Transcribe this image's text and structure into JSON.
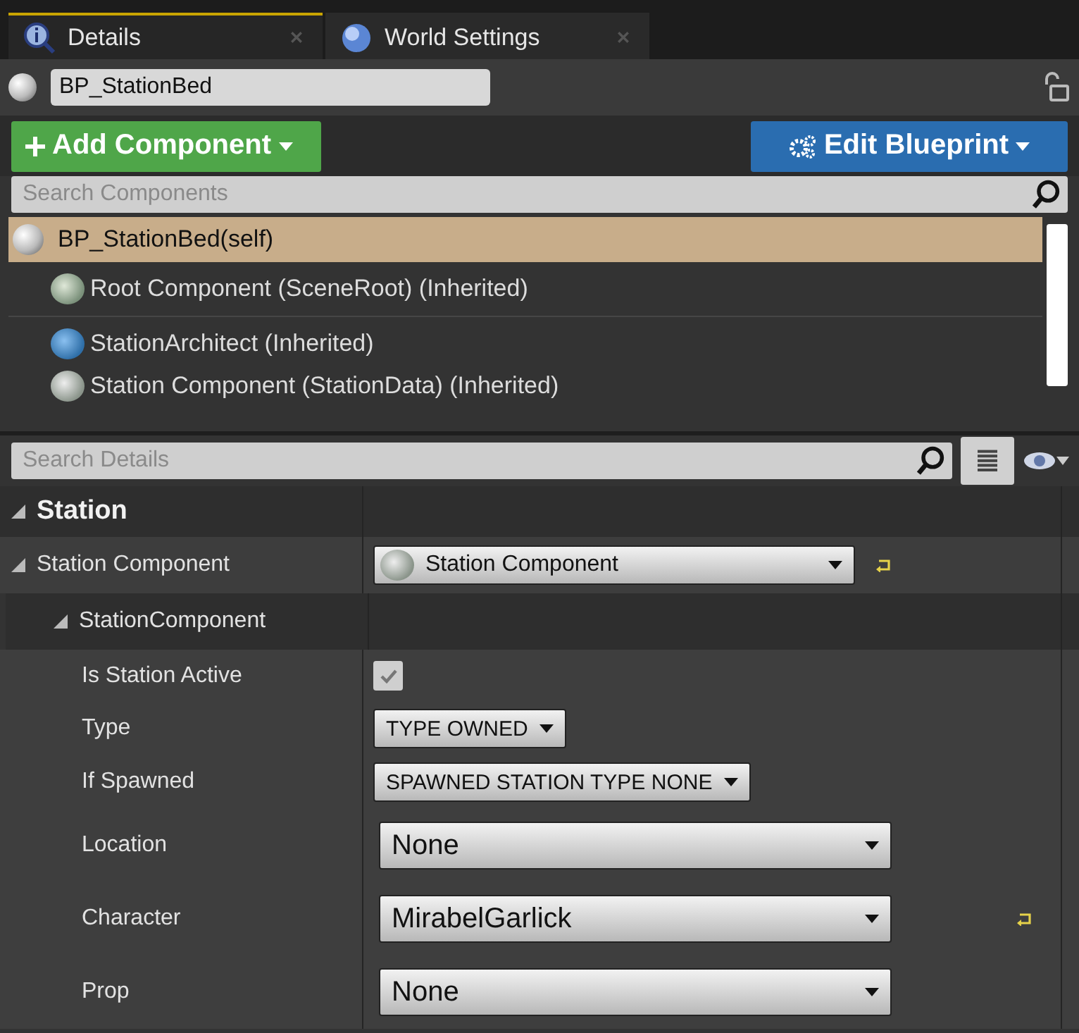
{
  "tabs": [
    {
      "label": "Details",
      "selected": true
    },
    {
      "label": "World Settings",
      "selected": false
    }
  ],
  "actor_name": {
    "value": "BP_StationBed"
  },
  "add_button": {
    "label": "Add Component"
  },
  "edit_button": {
    "label": "Edit Blueprint"
  },
  "component_search": {
    "placeholder": "Search Components"
  },
  "components": [
    {
      "label": "BP_StationBed(self)",
      "selected": true,
      "children": [
        {
          "label": "Root Component (SceneRoot) (Inherited)",
          "selected": false
        },
        {
          "label": "StationArchitect (Inherited)",
          "selected": false
        },
        {
          "label": "Station Component (StationData) (Inherited)",
          "selected": false
        }
      ]
    }
  ],
  "details_search": {
    "placeholder": "Search Details"
  },
  "category": {
    "label": "Station",
    "expanded": true
  },
  "properties": [
    {
      "kind": "object",
      "label": "Station Component",
      "value": "Station Component",
      "expanded": true,
      "resettable": true,
      "children": [
        {
          "kind": "group",
          "label": "StationComponent",
          "expanded": true,
          "children": [
            {
              "kind": "checkbox",
              "label": "Is Station Active",
              "checked": true,
              "resettable": false
            },
            {
              "kind": "enum",
              "label": "Type",
              "value": "TYPE OWNED",
              "resettable": false
            },
            {
              "kind": "enum",
              "label": "If Spawned",
              "value": "SPAWNED STATION TYPE NONE",
              "resettable": false
            },
            {
              "kind": "combo",
              "label": "Location",
              "value": "None",
              "resettable": false
            },
            {
              "kind": "combo",
              "label": "Character",
              "value": "MirabelGarlick",
              "resettable": true
            },
            {
              "kind": "combo",
              "label": "Prop",
              "value": "None",
              "resettable": false
            }
          ]
        }
      ]
    }
  ]
}
